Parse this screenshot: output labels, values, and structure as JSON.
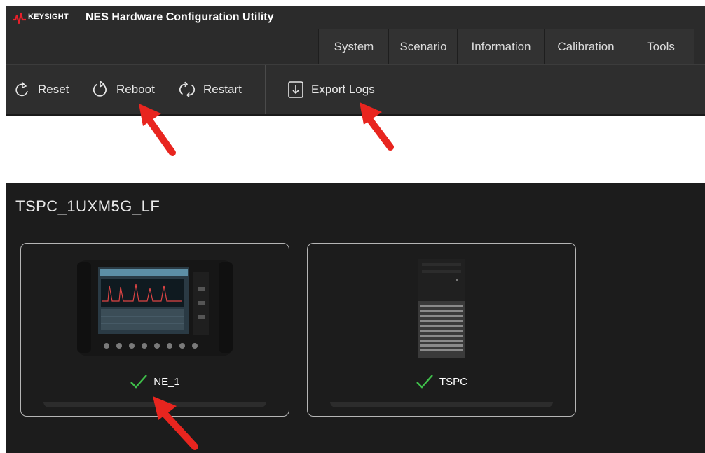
{
  "app": {
    "brand": "KEYSIGHT",
    "title": "NES Hardware Configuration Utility",
    "brand_color": "#e8202a"
  },
  "menu": [
    {
      "label": "System"
    },
    {
      "label": "Scenario"
    },
    {
      "label": "Information"
    },
    {
      "label": "Calibration"
    },
    {
      "label": "Tools"
    }
  ],
  "toolbar": {
    "reset_label": "Reset",
    "reboot_label": "Reboot",
    "restart_label": "Restart",
    "export_label": "Export Logs"
  },
  "system": {
    "name": "TSPC_1UXM5G_LF",
    "devices": [
      {
        "label": "NE_1",
        "status": "ok",
        "icon": "network-emulator-instrument"
      },
      {
        "label": "TSPC",
        "status": "ok",
        "icon": "tower-pc"
      }
    ]
  },
  "status_color": "#3fbf4a",
  "annotation_color": "#e8251f"
}
